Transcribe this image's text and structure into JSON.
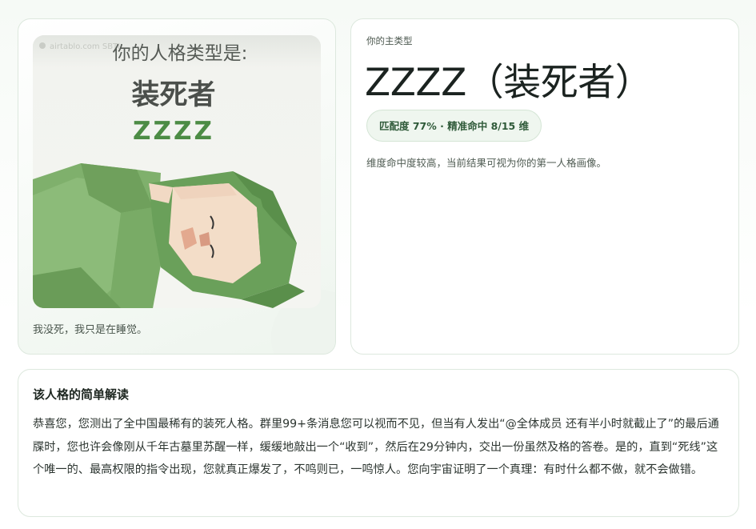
{
  "portrait": {
    "watermark": "airtablo.com SBTI",
    "heading": "你的人格类型是:",
    "type_name": "装死者",
    "type_code": "ZZZZ",
    "caption": "我没死，我只是在睡觉。"
  },
  "result": {
    "label": "你的主类型",
    "title": "ZZZZ（装死者）",
    "match_badge": "匹配度 77% · 精准命中 8/15 维",
    "description": "维度命中度较高，当前结果可视为你的第一人格画像。"
  },
  "interpretation": {
    "title": "该人格的简单解读",
    "body": "恭喜您，您测出了全中国最稀有的装死人格。群里99+条消息您可以视而不见，但当有人发出“@全体成员 还有半小时就截止了”的最后通牒时，您也许会像刚从千年古墓里苏醒一样，缓缓地敲出一个“收到”，然后在29分钟内，交出一份虽然及格的答卷。是的，直到“死线”这个唯一的、最高权限的指令出现，您就真正爆发了，不鸣则已，一鸣惊人。您向宇宙证明了一个真理：有时什么都不做，就不会做错。"
  },
  "colors": {
    "accent_green": "#5a9a4f",
    "badge_bg": "#eff6ef",
    "badge_text": "#2f5a39",
    "border": "#dde8de"
  }
}
